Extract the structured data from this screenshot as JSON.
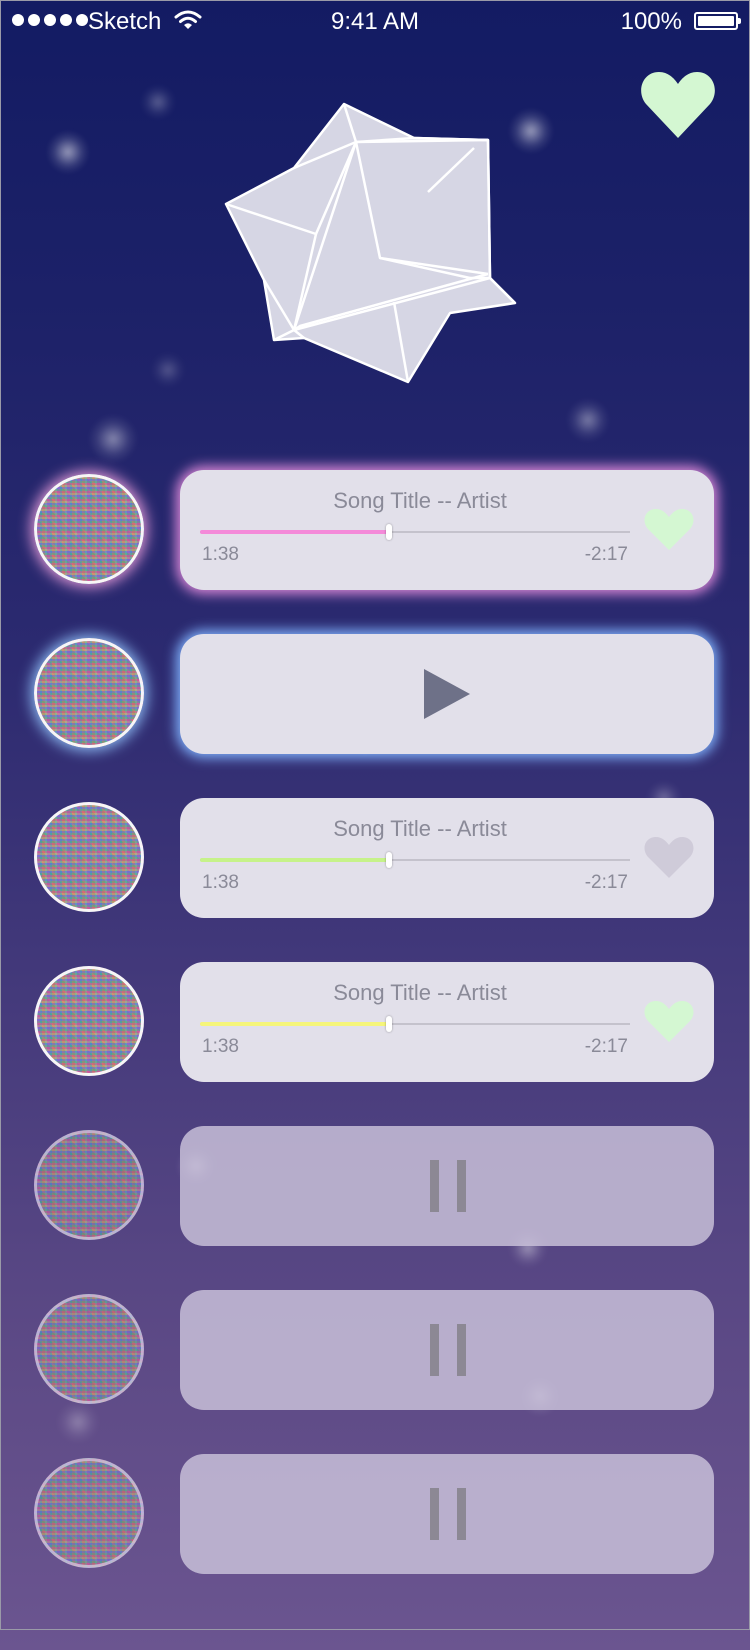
{
  "status_bar": {
    "carrier": "Sketch",
    "time": "9:41 AM",
    "battery": "100%"
  },
  "colors": {
    "favorite_heart": "#d4f7d2",
    "inactive_heart": "#cfcbd9",
    "progress_pink": "#f48ad9",
    "progress_green": "#c6f28a",
    "progress_yellow": "#f5f57a",
    "play_icon": "#6e7188",
    "pause_icon": "#8c8894"
  },
  "icons": {
    "top_favorite": "heart-icon",
    "hero": "origami-star-icon",
    "play": "play-icon",
    "pause": "pause-icon"
  },
  "tracks": [
    {
      "state": "playing",
      "title": "Song Title -- Artist",
      "elapsed": "1:38",
      "remaining": "-2:17",
      "progress": 0.44,
      "favorited": true,
      "glow": "pink"
    },
    {
      "state": "play-button",
      "glow": "blue"
    },
    {
      "state": "playing",
      "title": "Song Title -- Artist",
      "elapsed": "1:38",
      "remaining": "-2:17",
      "progress": 0.44,
      "favorited": false
    },
    {
      "state": "playing",
      "title": "Song Title -- Artist",
      "elapsed": "1:38",
      "remaining": "-2:17",
      "progress": 0.44,
      "favorited": true
    },
    {
      "state": "paused"
    },
    {
      "state": "paused"
    },
    {
      "state": "paused"
    }
  ]
}
